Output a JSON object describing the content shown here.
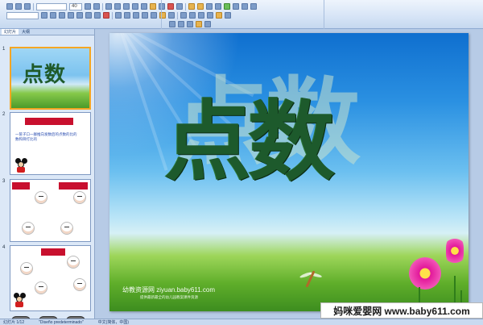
{
  "ribbon": {
    "font_size_value": "40"
  },
  "thumbnail_pane": {
    "tabs": [
      "幻灯片",
      "大纲"
    ],
    "slides": [
      {
        "number": "1",
        "title": "点数"
      },
      {
        "number": "2",
        "bar_text": "",
        "text": "一筐子口一群推向发数后的点数的比的数和目打比的"
      },
      {
        "number": "3"
      },
      {
        "number": "4"
      }
    ]
  },
  "slide": {
    "title": "点数",
    "watermark": "幼教资源网  ziyuan.baby611.com",
    "watermark_sub": "提供最新最全的幼儿园教案课件资源"
  },
  "status_bar": {
    "slide_counter": "幻灯片 1/12",
    "theme": "\"Diseño predeterminado\"",
    "language": "中文(简体，中国)"
  },
  "banner": {
    "text": "妈咪爱婴网 www.baby611.com"
  },
  "colors": {
    "title_green": "#1d5a2c",
    "selection_border": "#f5a623",
    "sky_blue": "#2b91e2",
    "grass_green": "#5fae2a"
  }
}
